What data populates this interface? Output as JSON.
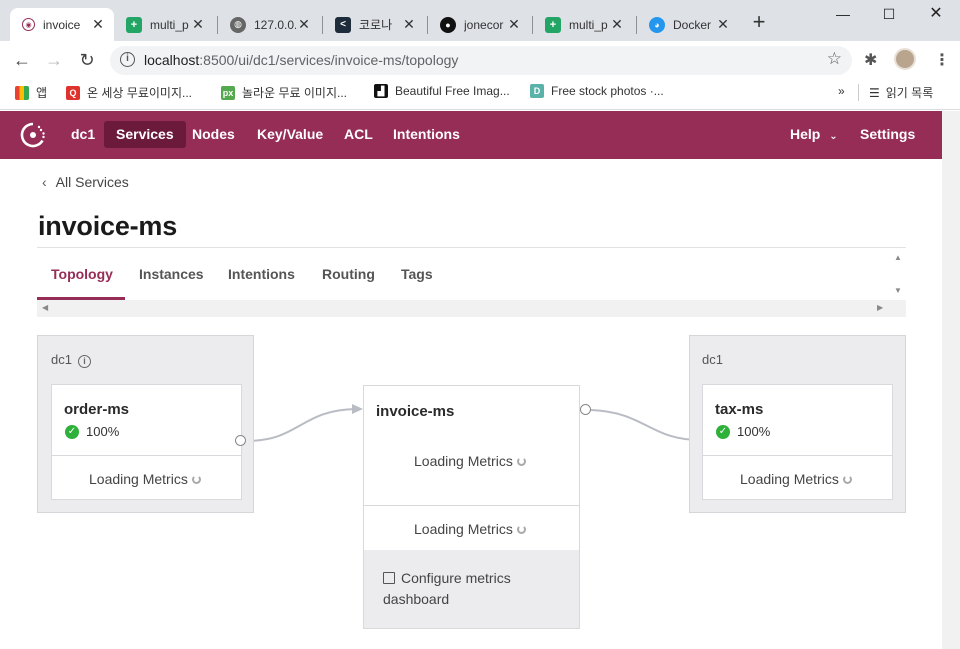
{
  "browser": {
    "tabs": [
      {
        "title": "invoice",
        "icon": "consul-icon",
        "active": true
      },
      {
        "title": "multi_p",
        "icon": "sheets-icon"
      },
      {
        "title": "127.0.0.",
        "icon": "globe-icon"
      },
      {
        "title": "코로나",
        "icon": "terminal-icon"
      },
      {
        "title": "jonecor",
        "icon": "github-icon"
      },
      {
        "title": "multi_p",
        "icon": "sheets-icon"
      },
      {
        "title": "Docker",
        "icon": "docker-icon"
      }
    ],
    "url_host": "localhost",
    "url_rest": ":8500/ui/dc1/services/invoice-ms/topology",
    "bookmarks": [
      {
        "label": "앱",
        "icon": "apps-grid-icon"
      },
      {
        "label": "온 세상 무료이미지...",
        "icon": "q-icon",
        "color": "#e0322d"
      },
      {
        "label": "놀라운 무료 이미지...",
        "icon": "px-icon",
        "color": "#54a84f"
      },
      {
        "label": "Beautiful Free Imag...",
        "icon": "unsplash-icon",
        "color": "#111111"
      },
      {
        "label": "Free stock photos ·...",
        "icon": "d-icon",
        "color": "#5bb2a8"
      }
    ],
    "reading_list": "읽기 목록"
  },
  "appbar": {
    "color": "#962d57",
    "datacenter": "dc1",
    "nav": [
      "Services",
      "Nodes",
      "Key/Value",
      "ACL",
      "Intentions"
    ],
    "active_nav": "Services",
    "help": "Help",
    "settings": "Settings"
  },
  "page": {
    "back_label": "All Services",
    "title": "invoice-ms",
    "tabs": [
      "Topology",
      "Instances",
      "Intentions",
      "Routing",
      "Tags"
    ],
    "active_tab": "Topology"
  },
  "topology": {
    "upstream_dc": {
      "label": "dc1",
      "service": "order-ms",
      "health": "100%",
      "metrics": "Loading Metrics"
    },
    "center": {
      "service": "invoice-ms",
      "metrics_top": "Loading Metrics",
      "metrics_bottom": "Loading Metrics",
      "configure": "Configure metrics dashboard"
    },
    "downstream_dc": {
      "label": "dc1",
      "service": "tax-ms",
      "health": "100%",
      "metrics": "Loading Metrics"
    }
  }
}
